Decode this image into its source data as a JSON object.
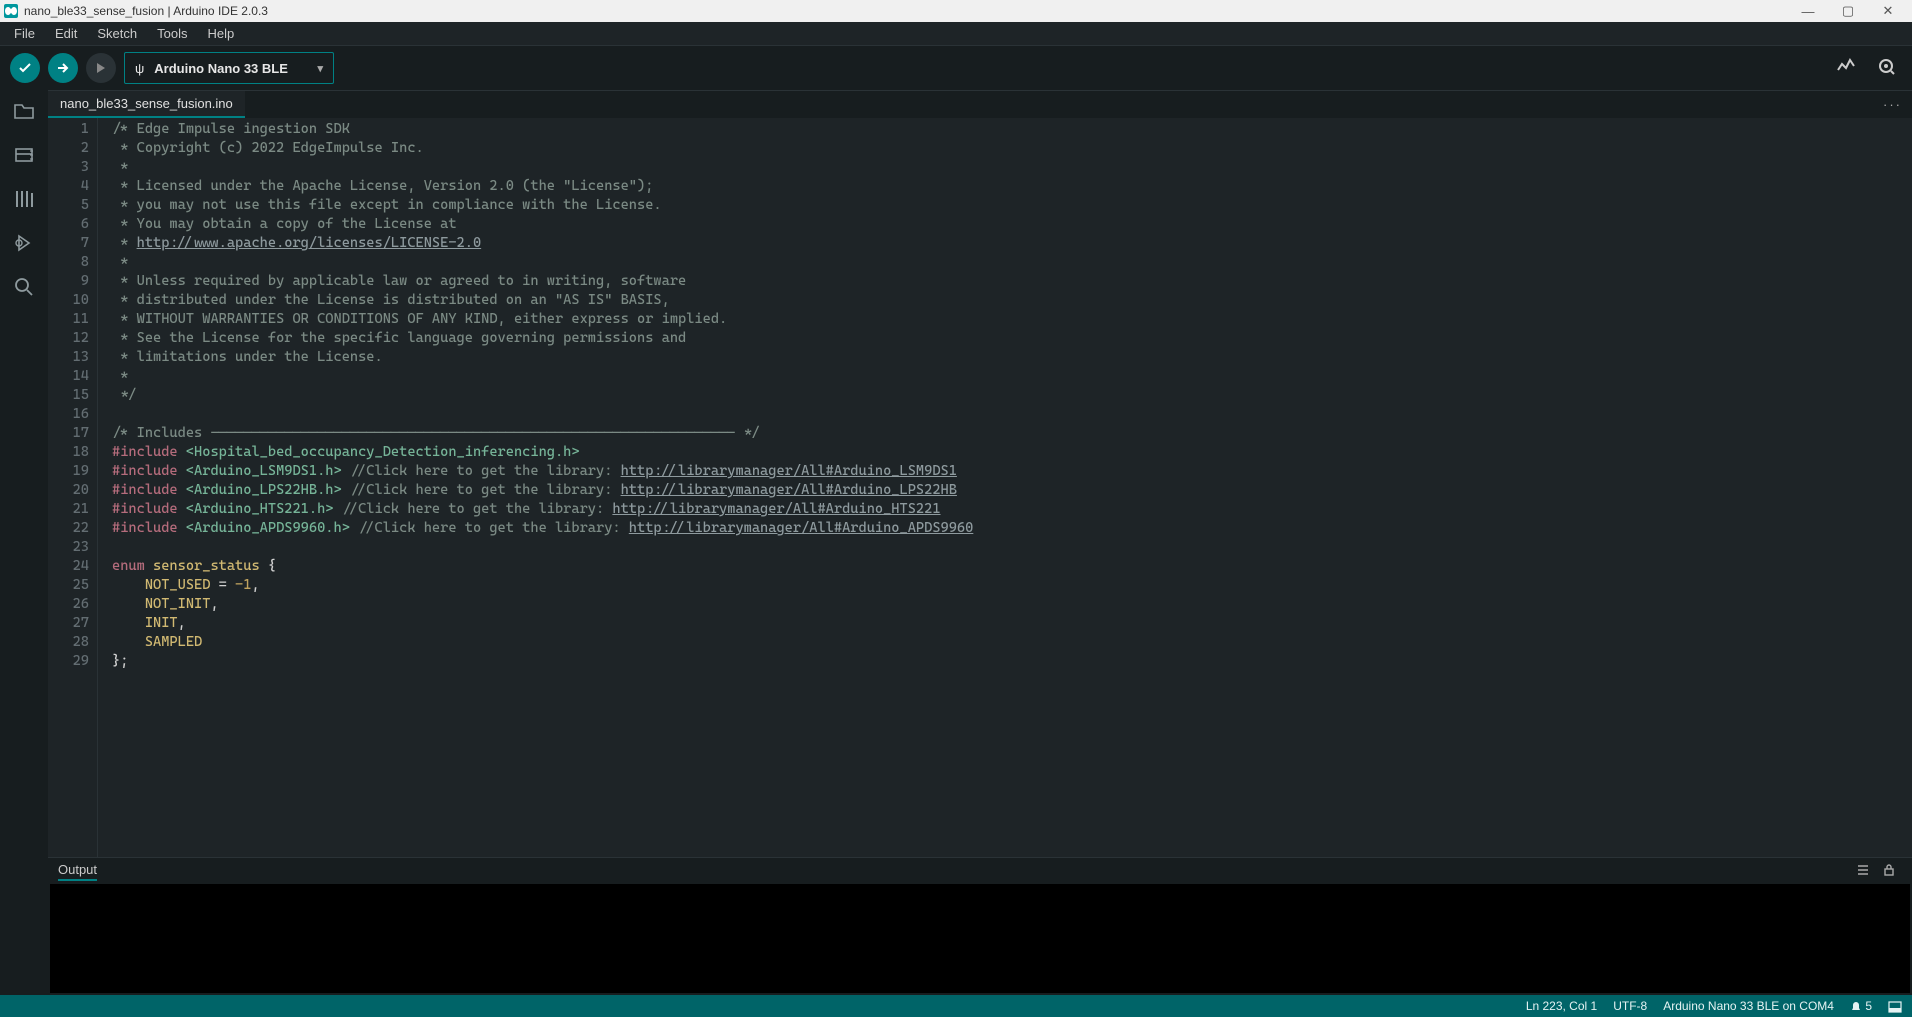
{
  "window": {
    "title": "nano_ble33_sense_fusion | Arduino IDE 2.0.3"
  },
  "menu": [
    "File",
    "Edit",
    "Sketch",
    "Tools",
    "Help"
  ],
  "toolbar": {
    "board_label": "Arduino Nano 33 BLE"
  },
  "tab": {
    "name": "nano_ble33_sense_fusion.ino"
  },
  "code": {
    "lines": [
      {
        "n": 1,
        "segs": [
          {
            "t": "/* Edge Impulse ingestion SDK",
            "c": "comment"
          }
        ]
      },
      {
        "n": 2,
        "segs": [
          {
            "t": " * Copyright (c) 2022 EdgeImpulse Inc.",
            "c": "comment"
          }
        ]
      },
      {
        "n": 3,
        "segs": [
          {
            "t": " *",
            "c": "comment"
          }
        ]
      },
      {
        "n": 4,
        "segs": [
          {
            "t": " * Licensed under the Apache License, Version 2.0 (the \"License\");",
            "c": "comment"
          }
        ]
      },
      {
        "n": 5,
        "segs": [
          {
            "t": " * you may not use this file except in compliance with the License.",
            "c": "comment"
          }
        ]
      },
      {
        "n": 6,
        "segs": [
          {
            "t": " * You may obtain a copy of the License at",
            "c": "comment"
          }
        ]
      },
      {
        "n": 7,
        "segs": [
          {
            "t": " * ",
            "c": "comment"
          },
          {
            "t": "http://www.apache.org/licenses/LICENSE-2.0",
            "c": "link"
          }
        ]
      },
      {
        "n": 8,
        "segs": [
          {
            "t": " *",
            "c": "comment"
          }
        ]
      },
      {
        "n": 9,
        "segs": [
          {
            "t": " * Unless required by applicable law or agreed to in writing, software",
            "c": "comment"
          }
        ]
      },
      {
        "n": 10,
        "segs": [
          {
            "t": " * distributed under the License is distributed on an \"AS IS\" BASIS,",
            "c": "comment"
          }
        ]
      },
      {
        "n": 11,
        "segs": [
          {
            "t": " * WITHOUT WARRANTIES OR CONDITIONS OF ANY KIND, either express or implied.",
            "c": "comment"
          }
        ]
      },
      {
        "n": 12,
        "segs": [
          {
            "t": " * See the License for the specific language governing permissions and",
            "c": "comment"
          }
        ]
      },
      {
        "n": 13,
        "segs": [
          {
            "t": " * limitations under the License.",
            "c": "comment"
          }
        ]
      },
      {
        "n": 14,
        "segs": [
          {
            "t": " *",
            "c": "comment"
          }
        ]
      },
      {
        "n": 15,
        "segs": [
          {
            "t": " */",
            "c": "comment"
          }
        ]
      },
      {
        "n": 16,
        "segs": [
          {
            "t": "",
            "c": "comment"
          }
        ]
      },
      {
        "n": 17,
        "segs": [
          {
            "t": "/* Includes ---------------------------------------------------------------- */",
            "c": "comment"
          }
        ]
      },
      {
        "n": 18,
        "segs": [
          {
            "t": "#include ",
            "c": "prep"
          },
          {
            "t": "<Hospital_bed_occupancy_Detection_inferencing.h>",
            "c": "inc"
          }
        ]
      },
      {
        "n": 19,
        "segs": [
          {
            "t": "#include ",
            "c": "prep"
          },
          {
            "t": "<Arduino_LSM9DS1.h>",
            "c": "inc"
          },
          {
            "t": " ",
            "c": "punc"
          },
          {
            "t": "//Click here to get the library: ",
            "c": "comment"
          },
          {
            "t": "http://librarymanager/All#Arduino_LSM9DS1",
            "c": "link"
          }
        ]
      },
      {
        "n": 20,
        "segs": [
          {
            "t": "#include ",
            "c": "prep"
          },
          {
            "t": "<Arduino_LPS22HB.h>",
            "c": "inc"
          },
          {
            "t": " ",
            "c": "punc"
          },
          {
            "t": "//Click here to get the library: ",
            "c": "comment"
          },
          {
            "t": "http://librarymanager/All#Arduino_LPS22HB",
            "c": "link"
          }
        ]
      },
      {
        "n": 21,
        "segs": [
          {
            "t": "#include ",
            "c": "prep"
          },
          {
            "t": "<Arduino_HTS221.h>",
            "c": "inc"
          },
          {
            "t": " ",
            "c": "punc"
          },
          {
            "t": "//Click here to get the library: ",
            "c": "comment"
          },
          {
            "t": "http://librarymanager/All#Arduino_HTS221",
            "c": "link"
          }
        ]
      },
      {
        "n": 22,
        "segs": [
          {
            "t": "#include ",
            "c": "prep"
          },
          {
            "t": "<Arduino_APDS9960.h>",
            "c": "inc"
          },
          {
            "t": " ",
            "c": "punc"
          },
          {
            "t": "//Click here to get the library: ",
            "c": "comment"
          },
          {
            "t": "http://librarymanager/All#Arduino_APDS9960",
            "c": "link"
          }
        ]
      },
      {
        "n": 23,
        "segs": [
          {
            "t": "",
            "c": "comment"
          }
        ]
      },
      {
        "n": 24,
        "segs": [
          {
            "t": "enum",
            "c": "kw"
          },
          {
            "t": " ",
            "c": "punc"
          },
          {
            "t": "sensor_status",
            "c": "type"
          },
          {
            "t": " {",
            "c": "punc"
          }
        ]
      },
      {
        "n": 25,
        "segs": [
          {
            "t": "    ",
            "c": "punc"
          },
          {
            "t": "NOT_USED",
            "c": "ident"
          },
          {
            "t": " = ",
            "c": "punc"
          },
          {
            "t": "-1",
            "c": "num"
          },
          {
            "t": ",",
            "c": "punc"
          }
        ]
      },
      {
        "n": 26,
        "segs": [
          {
            "t": "    ",
            "c": "punc"
          },
          {
            "t": "NOT_INIT",
            "c": "ident"
          },
          {
            "t": ",",
            "c": "punc"
          }
        ]
      },
      {
        "n": 27,
        "segs": [
          {
            "t": "    ",
            "c": "punc"
          },
          {
            "t": "INIT",
            "c": "ident"
          },
          {
            "t": ",",
            "c": "punc"
          }
        ]
      },
      {
        "n": 28,
        "segs": [
          {
            "t": "    ",
            "c": "punc"
          },
          {
            "t": "SAMPLED",
            "c": "ident"
          }
        ]
      },
      {
        "n": 29,
        "segs": [
          {
            "t": "};",
            "c": "punc"
          }
        ]
      }
    ]
  },
  "output": {
    "label": "Output"
  },
  "status": {
    "cursor": "Ln 223, Col 1",
    "encoding": "UTF-8",
    "board": "Arduino Nano 33 BLE on COM4",
    "notif_count": "5"
  },
  "icons": {
    "usb": "ψ",
    "check": "✓",
    "arrow": "→",
    "debug_tb": "⟫",
    "dd": "▾",
    "plotter": "〜",
    "monitor": "⦿",
    "more": "···",
    "folder": "▢",
    "board_mgr": "▤",
    "library": "≣",
    "debug": "▷",
    "search": "⌕",
    "wrap": "≡",
    "lock": "🔒",
    "bell": "🔔",
    "window": "▭"
  }
}
